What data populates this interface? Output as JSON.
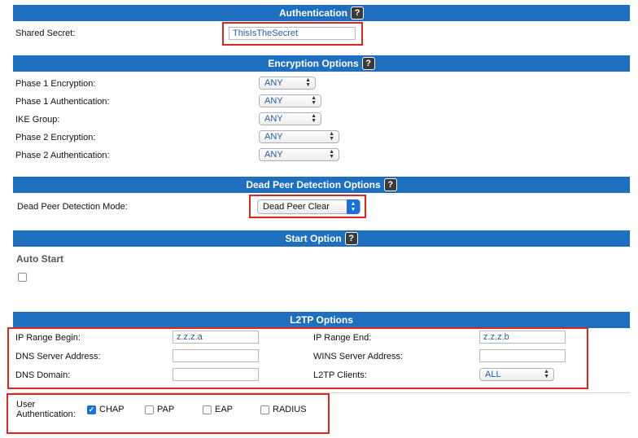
{
  "authentication": {
    "title": "Authentication",
    "shared_secret_label": "Shared Secret:",
    "shared_secret_value": "ThisIsTheSecret"
  },
  "encryption": {
    "title": "Encryption Options",
    "rows": [
      {
        "label": "Phase 1 Encryption:",
        "value": "ANY"
      },
      {
        "label": "Phase 1 Authentication:",
        "value": "ANY"
      },
      {
        "label": "IKE Group:",
        "value": "ANY"
      },
      {
        "label": "Phase 2 Encryption:",
        "value": "ANY"
      },
      {
        "label": "Phase 2 Authentication:",
        "value": "ANY"
      }
    ]
  },
  "dpd": {
    "title": "Dead Peer Detection Options",
    "mode_label": "Dead Peer Detection Mode:",
    "mode_value": "Dead Peer Clear"
  },
  "start": {
    "title": "Start Option",
    "auto_start_label": "Auto Start",
    "auto_start_checked": false
  },
  "l2tp": {
    "title": "L2TP Options",
    "ip_range_begin_label": "IP Range Begin:",
    "ip_range_begin_value": "z.z.z.a",
    "ip_range_end_label": "IP Range End:",
    "ip_range_end_value": "z.z.z.b",
    "dns_server_label": "DNS Server Address:",
    "dns_server_value": "",
    "wins_server_label": "WINS Server Address:",
    "wins_server_value": "",
    "dns_domain_label": "DNS Domain:",
    "dns_domain_value": "",
    "clients_label": "L2TP Clients:",
    "clients_value": "ALL"
  },
  "user_auth": {
    "label_line1": "User",
    "label_line2": "Authentication:",
    "options": [
      {
        "label": "CHAP",
        "checked": true
      },
      {
        "label": "PAP",
        "checked": false
      },
      {
        "label": "EAP",
        "checked": false
      },
      {
        "label": "RADIUS",
        "checked": false
      }
    ]
  },
  "help_glyph": "?",
  "colors": {
    "header": "#1f6fc1",
    "highlight": "#e0261c",
    "checkbox": "#1a6fe0"
  }
}
